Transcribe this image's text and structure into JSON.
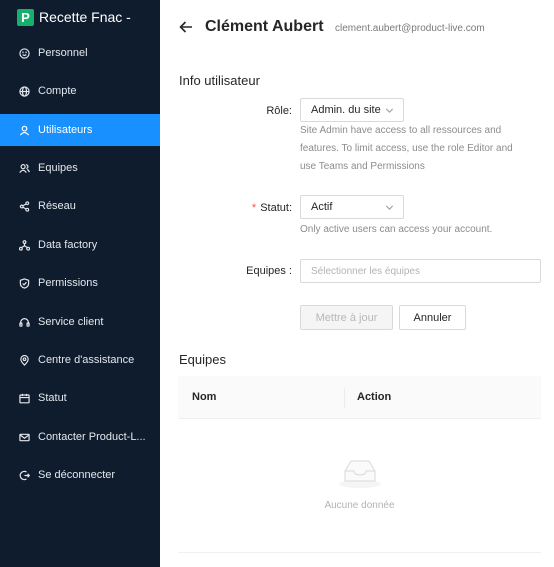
{
  "sidebar": {
    "brand_letter": "P",
    "brand_name": "Recette Fnac -",
    "items": [
      {
        "label": "Personnel",
        "icon": "smile-icon"
      },
      {
        "label": "Compte",
        "icon": "globe-icon"
      },
      {
        "label": "Utilisateurs",
        "icon": "user-icon",
        "active": true
      },
      {
        "label": "Equipes",
        "icon": "team-icon"
      },
      {
        "label": "Réseau",
        "icon": "share-icon"
      },
      {
        "label": "Data factory",
        "icon": "cluster-icon"
      },
      {
        "label": "Permissions",
        "icon": "shield-icon"
      },
      {
        "label": "Service client",
        "icon": "headset-icon"
      },
      {
        "label": "Centre d'assistance",
        "icon": "location-icon"
      },
      {
        "label": "Statut",
        "icon": "calendar-icon"
      },
      {
        "label": "Contacter Product-L...",
        "icon": "mail-icon"
      },
      {
        "label": "Se déconnecter",
        "icon": "logout-icon"
      }
    ],
    "active_color": "#1890ff",
    "background": "#0f1c2e"
  },
  "header": {
    "name": "Clément Aubert",
    "email": "clement.aubert@product-live.com"
  },
  "form": {
    "section_title": "Info utilisateur",
    "role_label": "Rôle:",
    "role_value": "Admin. du site",
    "role_help": [
      "Site Admin have access to all ressources and",
      "features. To limit access, use the role Editor and",
      "use Teams and Permissions"
    ],
    "status_required": "*",
    "status_label": "Statut:",
    "status_value": "Actif",
    "status_help": "Only active users can access your account.",
    "teams_label": "Equipes :",
    "teams_placeholder": "Sélectionner les équipes",
    "update_button": "Mettre à jour",
    "cancel_button": "Annuler"
  },
  "teams_table": {
    "section_title": "Equipes",
    "columns": [
      "Nom",
      "Action"
    ],
    "empty_text": "Aucune donnée"
  }
}
